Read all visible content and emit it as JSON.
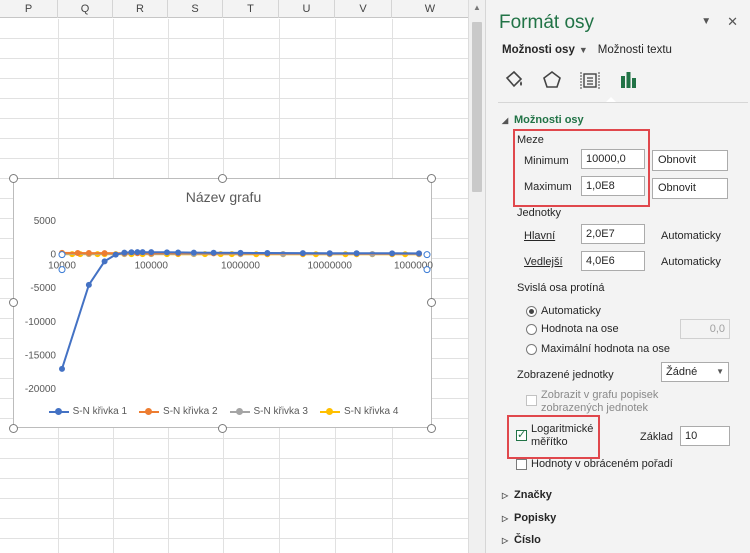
{
  "sheet": {
    "columns": [
      "P",
      "Q",
      "R",
      "S",
      "T",
      "U",
      "V",
      "W"
    ]
  },
  "chart": {
    "title": "Název grafu",
    "legend": [
      {
        "name": "S-N křivka 1",
        "color": "#4472c4"
      },
      {
        "name": "S-N křivka 2",
        "color": "#ed7d31"
      },
      {
        "name": "S-N křivka 3",
        "color": "#a5a5a5"
      },
      {
        "name": "S-N křivka 4",
        "color": "#ffc000"
      }
    ]
  },
  "chart_data": {
    "type": "scatter",
    "title": "Název grafu",
    "x_scale": "log",
    "xlim": [
      10000,
      100000000
    ],
    "ylim": [
      -20000,
      5000
    ],
    "y_ticks": [
      "5000",
      "0",
      "-5000",
      "-10000",
      "-15000",
      "-20000"
    ],
    "x_ticks": [
      "10000",
      "100000",
      "1000000",
      "10000000",
      "100000000"
    ],
    "grid": false,
    "legend_position": "bottom",
    "series": [
      {
        "name": "S-N křivka 1",
        "color": "#4472c4",
        "x": [
          10000,
          20000,
          30000,
          40000,
          50000,
          60000,
          70000,
          80000,
          100000,
          150000,
          200000,
          300000,
          500000,
          1000000,
          2000000,
          5000000,
          10000000,
          20000000,
          50000000,
          100000000
        ],
        "y": [
          -17000,
          -4500,
          -1000,
          0,
          300,
          350,
          360,
          360,
          360,
          340,
          320,
          300,
          280,
          260,
          240,
          220,
          210,
          200,
          190,
          180
        ]
      },
      {
        "name": "S-N křivka 2",
        "color": "#ed7d31",
        "x": [
          10000,
          15000,
          20000,
          30000,
          50000,
          70000,
          100000,
          200000,
          500000,
          1000000,
          2000000,
          5000000,
          10000000,
          20000000,
          50000000,
          100000000
        ],
        "y": [
          260,
          240,
          230,
          220,
          210,
          200,
          195,
          190,
          180,
          175,
          170,
          165,
          160,
          155,
          150,
          145
        ]
      },
      {
        "name": "S-N křivka 3",
        "color": "#a5a5a5",
        "x": [
          10000,
          20000,
          50000,
          100000,
          300000,
          1000000,
          3000000,
          10000000,
          30000000,
          100000000
        ],
        "y": [
          120,
          115,
          110,
          105,
          100,
          98,
          95,
          92,
          90,
          88
        ]
      },
      {
        "name": "S-N křivka 4",
        "color": "#ffc000",
        "x": [
          10000,
          13000,
          16000,
          20000,
          25000,
          30000,
          40000,
          50000,
          60000,
          80000,
          100000,
          150000,
          200000,
          300000,
          400000,
          600000,
          800000,
          1000000,
          1500000,
          2000000,
          3000000,
          5000000,
          7000000,
          10000000,
          15000000,
          20000000,
          30000000,
          50000000,
          70000000,
          100000000
        ],
        "y": [
          80,
          78,
          76,
          75,
          74,
          73,
          72,
          71,
          70,
          69,
          68,
          67,
          66,
          65,
          64,
          63,
          62,
          61,
          60,
          59,
          58,
          57,
          56,
          55,
          54,
          53,
          52,
          51,
          50,
          49
        ]
      }
    ]
  },
  "pane": {
    "title": "Formát osy",
    "close_icon": "✕",
    "tabs": {
      "options": "Možnosti osy",
      "text": "Možnosti textu"
    },
    "icons": [
      "fill-icon",
      "pentagon-effects-icon",
      "size-properties-icon",
      "bar-chart-icon"
    ],
    "sections": {
      "axis_options": "Možnosti osy",
      "marks": "Značky",
      "labels": "Popisky",
      "number": "Číslo"
    },
    "bounds": {
      "heading": "Meze",
      "min_label": "Minimum",
      "min_value": "10000,0",
      "max_label": "Maximum",
      "max_value": "1,0E8",
      "reset": "Obnovit"
    },
    "units": {
      "heading": "Jednotky",
      "major_label": "Hlavní",
      "major_value": "2,0E7",
      "minor_label": "Vedlejší",
      "minor_value": "4,0E6",
      "auto": "Automaticky"
    },
    "cross": {
      "heading": "Svislá osa protíná",
      "auto": "Automaticky",
      "value": "Hodnota na ose",
      "value_field": "0,0",
      "max": "Maximální hodnota na ose"
    },
    "display_units": {
      "label": "Zobrazené jednotky",
      "value": "Žádné",
      "show_label": "Zobrazit v grafu popisek zobrazených jednotek"
    },
    "log": {
      "label": "Logaritmické měřítko",
      "base_label": "Základ",
      "base_value": "10"
    },
    "reverse": "Hodnoty v obráceném pořadí"
  }
}
